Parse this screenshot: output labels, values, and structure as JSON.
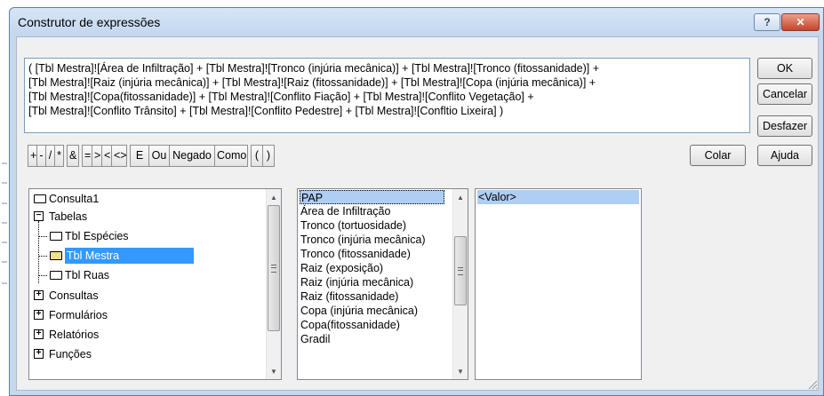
{
  "window": {
    "title": "Construtor de expressões",
    "help_label": "?",
    "close_label": "✕"
  },
  "expression": {
    "text": "( [Tbl Mestra]![Área de Infiltração] + [Tbl Mestra]![Tronco (injúria mecânica)] + [Tbl Mestra]![Tronco (fitossanidade)] +\n[Tbl Mestra]![Raiz (injúria mecânica)] + [Tbl Mestra]![Raiz (fitossanidade)] + [Tbl Mestra]![Copa (injúria mecânica)] +\n[Tbl Mestra]![Copa(fitossanidade)] + [Tbl Mestra]![Conflito Fiação] + [Tbl Mestra]![Conflito Vegetação] +\n[Tbl Mestra]![Conflito Trânsito] + [Tbl Mestra]![Conflito Pedestre] + [Tbl Mestra]![Confltio Lixeira] )"
  },
  "buttons": {
    "ok": "OK",
    "cancel": "Cancelar",
    "undo": "Desfazer",
    "paste": "Colar",
    "help": "Ajuda"
  },
  "operators": [
    "+",
    "-",
    "/",
    "*",
    "&",
    "=",
    ">",
    "<",
    "<>",
    "E",
    "Ou",
    "Negado",
    "Como",
    "(",
    ")"
  ],
  "tree": {
    "items": [
      {
        "label": "Consulta1"
      },
      {
        "label": "Tabelas"
      },
      {
        "label": "Tbl Espécies"
      },
      {
        "label": "Tbl Mestra"
      },
      {
        "label": "Tbl Ruas"
      },
      {
        "label": "Consultas"
      },
      {
        "label": "Formulários"
      },
      {
        "label": "Relatórios"
      },
      {
        "label": "Funções"
      }
    ]
  },
  "fields": {
    "items": [
      "PAP",
      "Área de Infiltração",
      "Tronco (tortuosidade)",
      "Tronco (injúria mecânica)",
      "Tronco (fitossanidade)",
      "Raiz (exposição)",
      "Raiz (injúria mecânica)",
      "Raiz (fitossanidade)",
      "Copa (injúria mecânica)",
      "Copa(fitossanidade)",
      "Gradil"
    ]
  },
  "values": {
    "items": [
      "<Valor>"
    ]
  },
  "colors": {
    "selection": "#3399ff",
    "focus_highlight": "#aecef4",
    "close_button": "#c4452b",
    "frame": "#c6d8ee"
  }
}
